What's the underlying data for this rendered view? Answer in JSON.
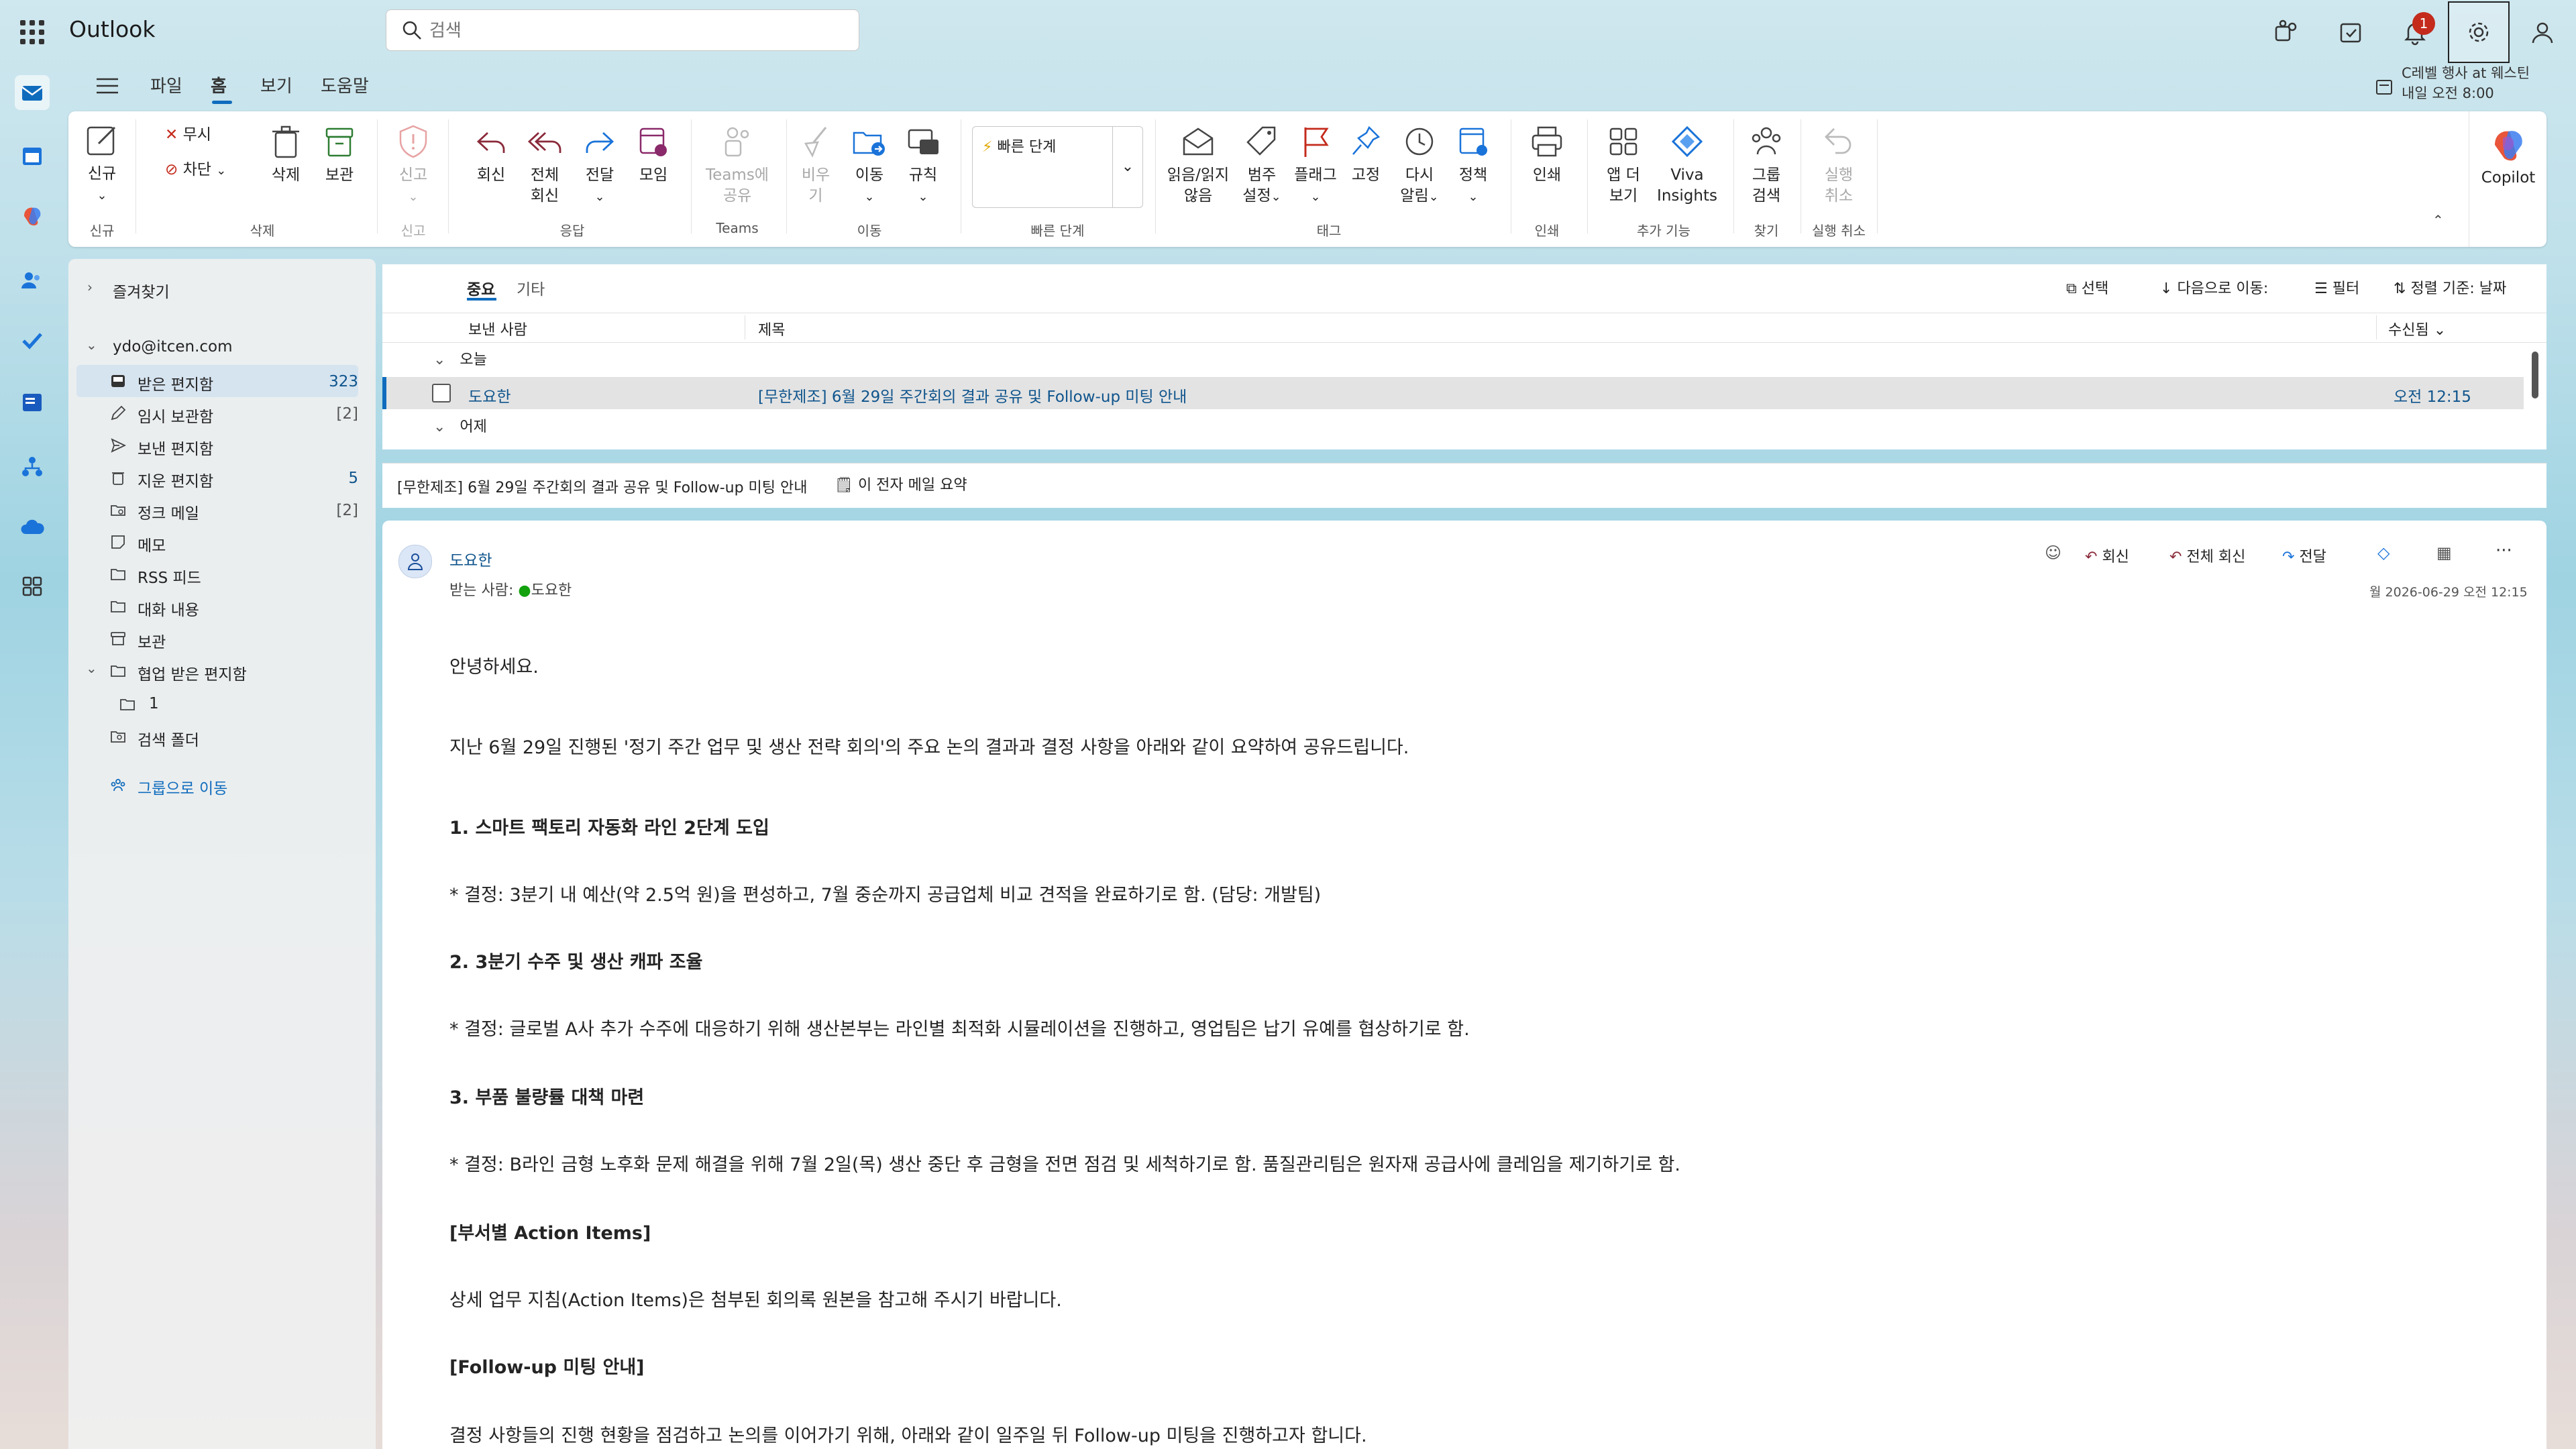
{
  "app": {
    "title": "Outlook"
  },
  "search": {
    "placeholder": "검색"
  },
  "topbar": {
    "notification_count": "1"
  },
  "menu": {
    "tabs": [
      "파일",
      "홈",
      "보기",
      "도움말"
    ]
  },
  "event": {
    "title": "C레벨 행사 at 웨스틴",
    "time": "내일 오전 8:00"
  },
  "ribbon": {
    "new": "신규",
    "new_group": "신규",
    "ignore": "무시",
    "block": "차단",
    "delete": "삭제",
    "archive": "보관",
    "delete_group": "삭제",
    "report": "신고",
    "report_group": "신고",
    "reply": "회신",
    "reply_all_1": "전체",
    "reply_all_2": "회신",
    "forward": "전달",
    "meeting": "모임",
    "respond_group": "응답",
    "teams_share_1": "Teams에",
    "teams_share_2": "공유",
    "teams_group": "Teams",
    "sweep": "비우기",
    "move": "이동",
    "rules": "규칙",
    "move_group": "이동",
    "quick_steps": "빠른 단계",
    "quick_steps_group": "빠른 단계",
    "read_unread_1": "읽음/읽지",
    "read_unread_2": "않음",
    "categorize_1": "범주",
    "categorize_2": "설정",
    "flag": "플래그",
    "pin": "고정",
    "snooze_1": "다시",
    "snooze_2": "알림",
    "policy": "정책",
    "tags_group": "태그",
    "print": "인쇄",
    "print_group": "인쇄",
    "apps_1": "앱 더",
    "apps_2": "보기",
    "viva_1": "Viva",
    "viva_2": "Insights",
    "addins_group": "추가 기능",
    "group_search_1": "그룹",
    "group_search_2": "검색",
    "find_group": "찾기",
    "undo_1": "실행",
    "undo_2": "취소",
    "undo_group": "실행 취소",
    "copilot": "Copilot"
  },
  "folders": {
    "favorites": "즐겨찾기",
    "account": "ydo@itcen.com",
    "items": [
      {
        "label": "받은 편지함",
        "count": "323"
      },
      {
        "label": "임시 보관함",
        "count": "[2]"
      },
      {
        "label": "보낸 편지함",
        "count": ""
      },
      {
        "label": "지운 편지함",
        "count": "5"
      },
      {
        "label": "정크 메일",
        "count": "[2]"
      },
      {
        "label": "메모",
        "count": ""
      },
      {
        "label": "RSS 피드",
        "count": ""
      },
      {
        "label": "대화 내용",
        "count": ""
      },
      {
        "label": "보관",
        "count": ""
      },
      {
        "label": "협업 받은 편지함",
        "count": ""
      },
      {
        "label": "1",
        "count": ""
      },
      {
        "label": "검색 폴더",
        "count": ""
      }
    ],
    "go_to_groups": "그룹으로 이동"
  },
  "list": {
    "tab_focused": "중요",
    "tab_other": "기타",
    "select": "선택",
    "jump_to": "다음으로 이동:",
    "filter": "필터",
    "sort": "정렬 기준: 날짜",
    "col_from": "보낸 사람",
    "col_subject": "제목",
    "col_received": "수신됨",
    "group_today": "오늘",
    "group_yesterday": "어제",
    "row": {
      "from": "도요한",
      "subject": "[무한제조] 6월 29일 주간회의 결과 공유 및 Follow-up 미팅 안내",
      "time": "오전 12:15"
    }
  },
  "reading": {
    "subject": "[무한제조] 6월 29일 주간회의 결과 공유 및 Follow-up 미팅 안내",
    "summarize": "이 전자 메일 요약",
    "sender": "도요한",
    "to_label": "받는 사람:",
    "to_name": "도요한",
    "date": "월 2026-06-29 오전 12:15",
    "reply": "회신",
    "reply_all": "전체 회신",
    "forward": "전달",
    "body": [
      {
        "text": "안녕하세요.",
        "bold": false
      },
      {
        "text": "지난 6월 29일 진행된 '정기 주간 업무 및 생산 전략 회의'의 주요 논의 결과과 결정 사항을 아래와 같이 요약하여 공유드립니다.",
        "bold": false
      },
      {
        "text": "1. 스마트 팩토리 자동화 라인 2단계 도입",
        "bold": true
      },
      {
        "text": "* 결정: 3분기 내 예산(약 2.5억 원)을 편성하고, 7월 중순까지 공급업체 비교 견적을 완료하기로 함. (담당: 개발팀)",
        "bold": false
      },
      {
        "text": "2. 3분기 수주 및 생산 캐파 조율",
        "bold": true
      },
      {
        "text": "* 결정: 글로벌 A사 추가 수주에 대응하기 위해 생산본부는 라인별 최적화 시뮬레이션을 진행하고, 영업팀은 납기 유예를 협상하기로 함.",
        "bold": false
      },
      {
        "text": "3. 부품 불량률 대책 마련",
        "bold": true
      },
      {
        "text": "* 결정: B라인 금형 노후화 문제 해결을 위해 7월 2일(목) 생산 중단 후 금형을 전면 점검 및 세척하기로 함. 품질관리팀은 원자재 공급사에 클레임을 제기하기로 함.",
        "bold": false
      },
      {
        "text": "[부서별 Action Items]",
        "bold": true
      },
      {
        "text": "상세 업무 지침(Action Items)은 첨부된 회의록 원본을 참고해 주시기 바랍니다.",
        "bold": false
      },
      {
        "text": "[Follow-up 미팅 안내]",
        "bold": true
      },
      {
        "text": "결정 사항들의 진행 현황을 점검하고 논의를 이어가기 위해, 아래와 같이 일주일 뒤 Follow-up 미팅을 진행하고자 합니다.",
        "bold": false
      }
    ]
  }
}
